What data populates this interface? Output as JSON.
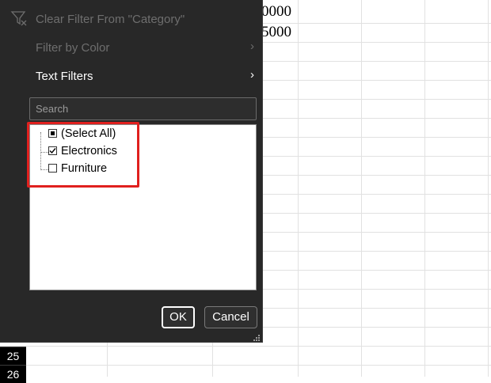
{
  "spreadsheet": {
    "cell_values": [
      "0000",
      "5000"
    ],
    "row_numbers": [
      "25",
      "26"
    ]
  },
  "filter_menu": {
    "clear_filter": "Clear Filter From \"Category\"",
    "filter_by_color": "Filter by Color",
    "text_filters": "Text Filters",
    "submenu_arrow": "›",
    "search_placeholder": "Search",
    "items": [
      {
        "label": "(Select All)",
        "state": "mixed"
      },
      {
        "label": "Electronics",
        "state": "checked"
      },
      {
        "label": "Furniture",
        "state": "unchecked"
      }
    ],
    "ok_label": "OK",
    "cancel_label": "Cancel"
  },
  "icons": {
    "clear_filter": "filter-clear-icon",
    "resize": "resize-grip-icon"
  },
  "colors": {
    "panel_bg": "#282828",
    "disabled_text": "#6e6e6e",
    "highlight_border": "#e0201e"
  }
}
